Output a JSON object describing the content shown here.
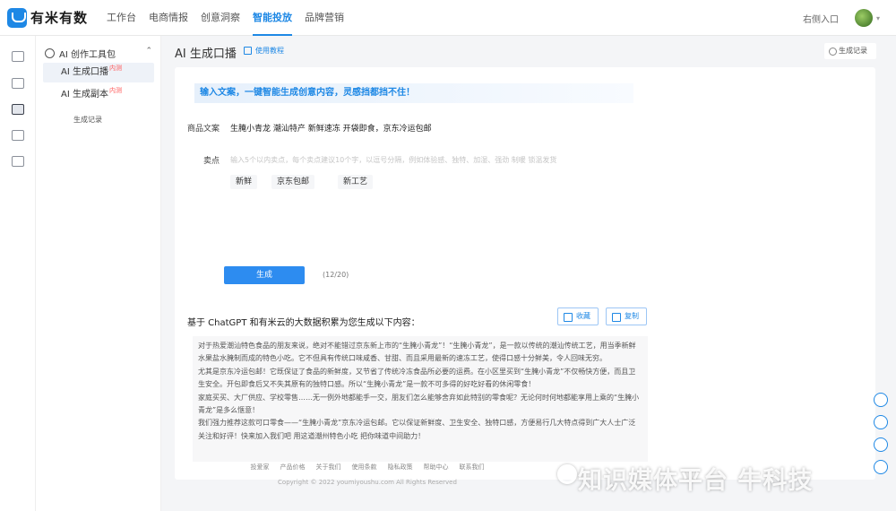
{
  "app": {
    "name": "有米有数"
  },
  "nav": {
    "items": [
      "工作台",
      "电商情报",
      "创意洞察",
      "智能投放",
      "品牌营销"
    ],
    "active_index": 3
  },
  "topbar": {
    "entry": "右侧入口",
    "caret": "▾"
  },
  "sidebar": {
    "section_title": "AI 创作工具包",
    "chevron": "⌃",
    "items": [
      {
        "label": "AI 生成口播",
        "badge": "内测",
        "active": true
      },
      {
        "label": "AI 生成副本",
        "badge": "内测",
        "active": false
      }
    ],
    "sub_item": "生成记录"
  },
  "main": {
    "title": "AI 生成口播",
    "tutorial": "使用教程",
    "record_button": "生成记录"
  },
  "form": {
    "banner": "输入文案，一键智能生成创意内容，灵感挡都挡不住！",
    "product_label": "商品文案",
    "product_value": "生腌小青龙 潮汕特产 新鲜速冻 开袋即食，京东冷运包邮",
    "selling_label": "卖点",
    "selling_placeholder": "输入5个以内卖点，每个卖点建议10个字，以逗号分隔，例如体验感、独特、加湿、强劲 制暖 锁温发货",
    "tags": [
      "新鲜",
      "京东包邮",
      "新工艺"
    ],
    "generate_button": "生成",
    "count": "(12/20)"
  },
  "result": {
    "title": "基于 ChatGPT 和有米云的大数据积累为您生成以下内容：",
    "collect_button": "收藏",
    "copy_button": "复制",
    "paragraphs": [
      "对于热爱潮汕特色食品的朋友来说，绝对不能错过京东新上市的“生腌小青龙”！“生腌小青龙”，是一款以传统的潮汕传统工艺，用当季新鲜水果盐水腌制而成的特色小吃。它不但具有传统口味咸香、甘甜、而且采用最新的速冻工艺，使得口感十分鲜美，令人回味无穷。",
      "尤其是京东冷运包邮！它既保证了食品的新鲜度，又节省了传统冷冻食品所必要的运费。在小区里买到“生腌小青龙”不仅畅快方便，而且卫生安全。开包即食后又不失其原有的独特口感。所以“生腌小青龙”是一款不可多得的好吃好看的休闲零食！",
      "家庭买买、大厂供应、学校零售……无一例外地都能手一交，朋友们怎么能够舍弃如此特别的零食呢？无论何时何地都能享用上乘的“生腌小青龙”是多么惬意！",
      "我们强力推荐这款可口零食——“生腌小青龙”京东冷运包邮。它以保证新鲜度、卫生安全、独特口感，方便易行几大特点得到广大人士广泛关注和好评！快来加入我们吧 用这道潮州特色小吃 把你味道中间助力！"
    ]
  },
  "footer": {
    "links": [
      "投爱家",
      "产品价格",
      "关于我们",
      "使用条款",
      "隐私政策",
      "帮助中心",
      "联系我们"
    ],
    "copyright": "Copyright © 2022 youmiyoushu.com All Rights Reserved"
  },
  "watermark": "知识媒体平台 牛科技"
}
